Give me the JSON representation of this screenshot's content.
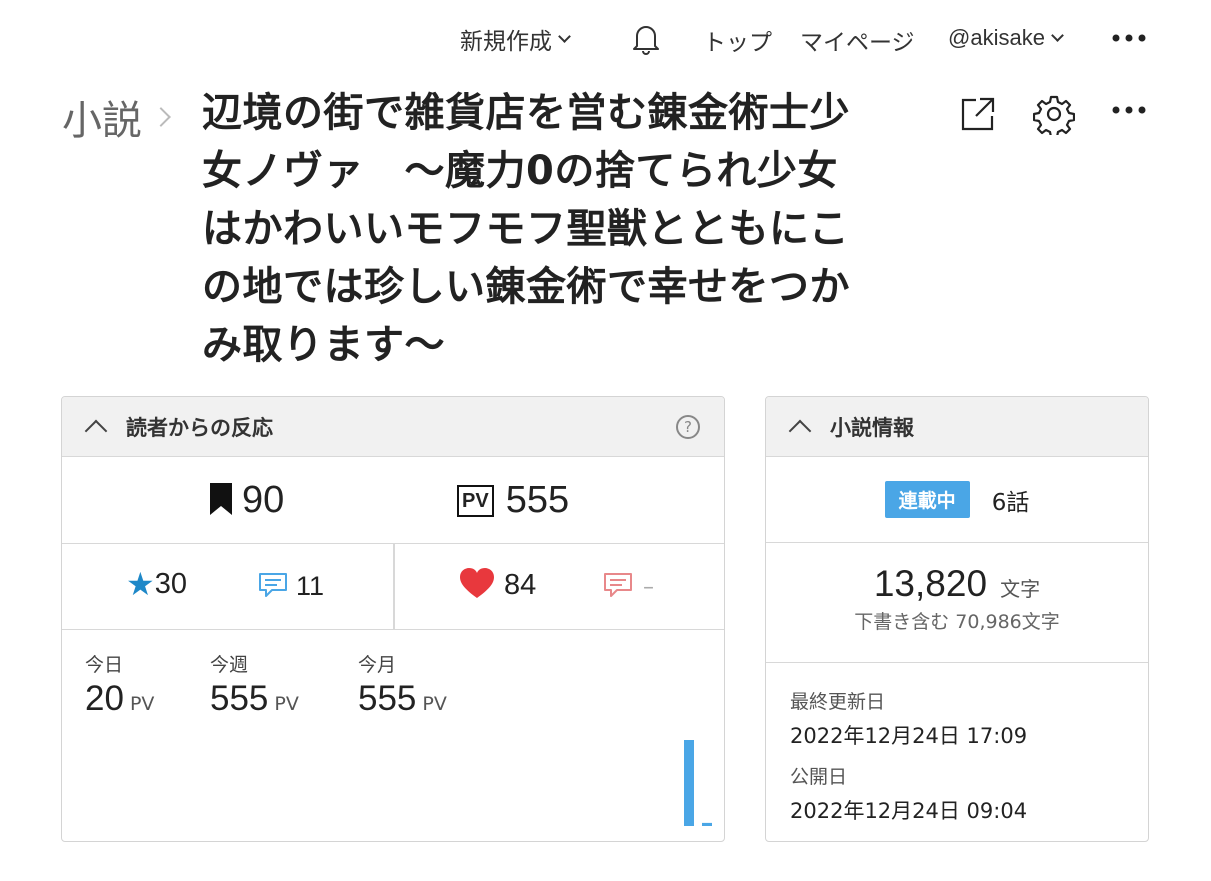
{
  "nav": {
    "new_label": "新規作成",
    "top_label": "トップ",
    "mypage_label": "マイページ",
    "user_label": "@akisake"
  },
  "header": {
    "breadcrumb": "小説",
    "title": "辺境の街で雑貨店を営む錬金術士少女ノヴァ　～魔力0の捨てられ少女はかわいいモフモフ聖獣とともにこの地では珍しい錬金術で幸せをつかみ取ります～"
  },
  "reactions": {
    "heading": "読者からの反応",
    "help": "?",
    "bookmarks": "90",
    "pv_icon": "PV",
    "pv_total": "555",
    "stars": "30",
    "star_reviews": "11",
    "hearts": "84",
    "heart_comments": "–",
    "today_label": "今日",
    "today_value": "20",
    "week_label": "今週",
    "week_value": "555",
    "month_label": "今月",
    "month_value": "555",
    "pv_unit": "PV",
    "mini_chart": [
      0,
      0,
      0,
      0,
      0,
      0,
      555,
      20
    ],
    "chart_color": "#4aa6e6"
  },
  "info": {
    "heading": "小説情報",
    "status_badge": "連載中",
    "episodes": "6話",
    "char_count": "13,820",
    "char_unit": "文字",
    "draft_note": "下書き含む 70,986文字",
    "updated_label": "最終更新日",
    "updated_value": "2022年12月24日 17:09",
    "published_label": "公開日",
    "published_value": "2022年12月24日 09:04"
  },
  "colors": {
    "accent": "#4aa6e6",
    "star": "#1e88c8",
    "heart": "#e8383d",
    "review": "#4aa6e6",
    "comment": "#e8888a"
  }
}
